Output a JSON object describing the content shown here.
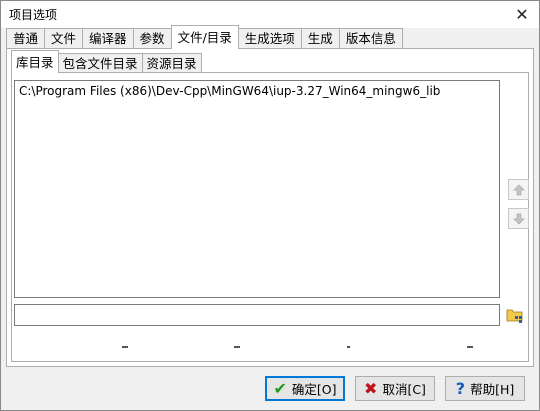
{
  "window": {
    "title": "项目选项",
    "close_glyph": "✕"
  },
  "tabs": [
    {
      "label": "普通"
    },
    {
      "label": "文件"
    },
    {
      "label": "编译器"
    },
    {
      "label": "参数"
    },
    {
      "label": "文件/目录",
      "active": true
    },
    {
      "label": "生成选项"
    },
    {
      "label": "生成"
    },
    {
      "label": "版本信息"
    }
  ],
  "subtabs": [
    {
      "label": "库目录",
      "active": true
    },
    {
      "label": "包含文件目录"
    },
    {
      "label": "资源目录"
    }
  ],
  "directory_list": {
    "items": [
      "C:\\Program Files (x86)\\Dev-Cpp\\MinGW64\\iup-3.27_Win64_mingw6_lib"
    ]
  },
  "path_input": {
    "value": ""
  },
  "icons": {
    "move_up": "up-arrow-icon",
    "move_down": "down-arrow-icon",
    "browse": "folder-icon"
  },
  "buttons": {
    "ok": "确定[O]",
    "cancel": "取消[C]",
    "help": "帮助[H]"
  },
  "colors": {
    "ok_check": "#1a9c1a",
    "cancel_x": "#c0141b",
    "help_q": "#1560bd",
    "default_border": "#0078d7"
  }
}
